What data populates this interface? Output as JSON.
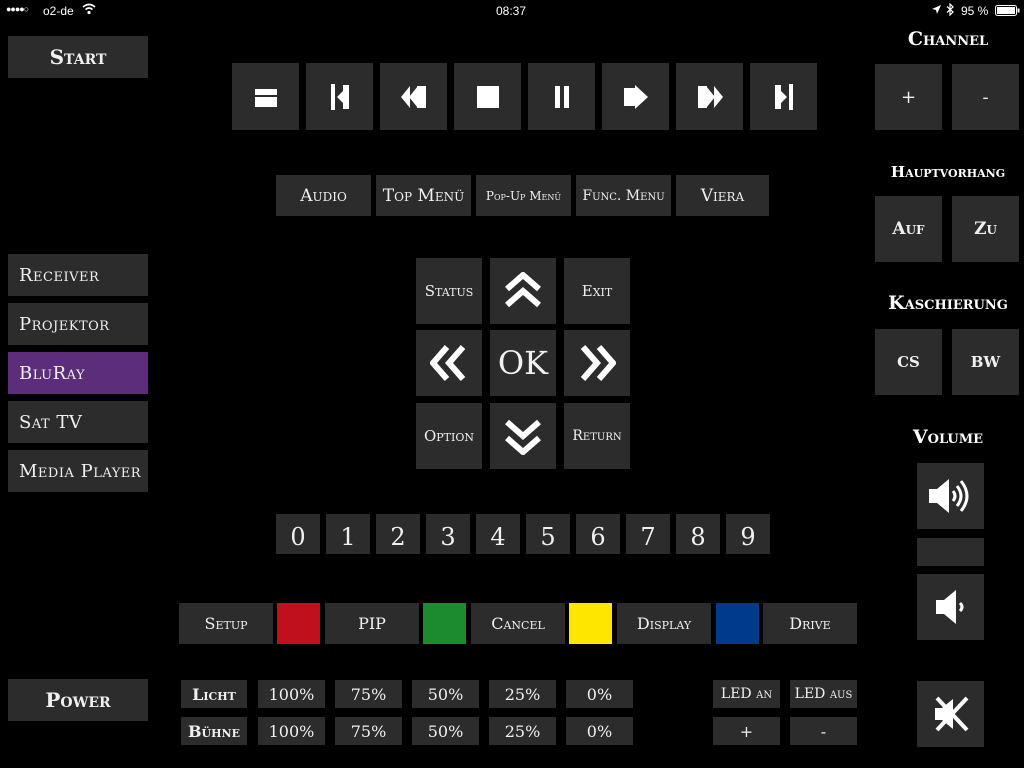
{
  "status_bar": {
    "signal": "●●●●○",
    "carrier": "o2-de",
    "time": "08:37",
    "battery": "95 %"
  },
  "sidebar": {
    "start": "Start",
    "devices": [
      {
        "label": "Receiver",
        "active": false
      },
      {
        "label": "Projektor",
        "active": false
      },
      {
        "label": "BluRay",
        "active": true
      },
      {
        "label": "Sat TV",
        "active": false
      },
      {
        "label": "Media Player",
        "active": false
      }
    ],
    "power": "Power"
  },
  "transport_icons": [
    "eject-icon",
    "skip-back-icon",
    "rewind-icon",
    "stop-icon",
    "pause-icon",
    "play-icon",
    "fast-forward-icon",
    "skip-forward-icon"
  ],
  "menu_buttons": [
    "Audio",
    "Top Menü",
    "Pop-Up Menü",
    "Func. Menu",
    "Viera"
  ],
  "nav": {
    "status": "Status",
    "exit": "Exit",
    "ok": "OK",
    "option": "Option",
    "return": "Return"
  },
  "digits": [
    "0",
    "1",
    "2",
    "3",
    "4",
    "5",
    "6",
    "7",
    "8",
    "9"
  ],
  "function_row": {
    "setup": "Setup",
    "pip": "PIP",
    "cancel": "Cancel",
    "display": "Display",
    "drive": "Drive",
    "colors": {
      "red": "#c0101e",
      "green": "#1c8a2e",
      "yellow": "#ffe600",
      "blue": "#003a8c"
    }
  },
  "light": {
    "licht_label": "Licht",
    "buehne_label": "Bühne",
    "levels": [
      "100%",
      "75%",
      "50%",
      "25%",
      "0%"
    ],
    "led_on": "LED an",
    "led_off": "LED aus",
    "plus": "+",
    "minus": "-"
  },
  "right_panel": {
    "channel_title": "Channel",
    "channel_plus": "+",
    "channel_minus": "-",
    "curtain_title": "Hauptvorhang",
    "curtain_open": "Auf",
    "curtain_close": "Zu",
    "masking_title": "Kaschierung",
    "masking_cs": "CS",
    "masking_bw": "BW",
    "volume_title": "Volume"
  },
  "accent_color": "#5b2d7a"
}
